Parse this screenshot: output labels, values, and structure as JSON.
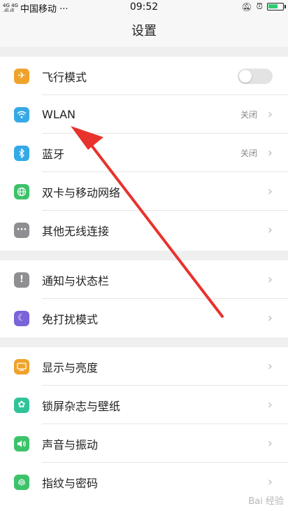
{
  "status_bar": {
    "network_top": "4G 4G",
    "network_bottom": ".ıll.ıll",
    "carrier": "中国移动 ···",
    "time": "09:52",
    "icons": [
      "silent-icon",
      "alarm-icon",
      "battery-icon"
    ]
  },
  "header": {
    "title": "设置"
  },
  "sections": [
    {
      "items": [
        {
          "id": "airplane",
          "label": "飞行模式",
          "icon": "airplane-icon",
          "color": "#f0a22b",
          "glyph": "✈",
          "control": "toggle",
          "toggle_on": false
        },
        {
          "id": "wlan",
          "label": "WLAN",
          "icon": "wifi-icon",
          "color": "#35a9e6",
          "glyph": "((·))",
          "value": "关闭",
          "control": "chevron"
        },
        {
          "id": "bluetooth",
          "label": "蓝牙",
          "icon": "bluetooth-icon",
          "color": "#35a9e6",
          "glyph": "ᛒ",
          "value": "关闭",
          "control": "chevron"
        },
        {
          "id": "dual-sim",
          "label": "双卡与移动网络",
          "icon": "globe-icon",
          "color": "#3cc36a",
          "glyph": "⊕",
          "control": "chevron"
        },
        {
          "id": "other-wireless",
          "label": "其他无线连接",
          "icon": "more-icon",
          "color": "#8e8e93",
          "glyph": "···",
          "control": "chevron"
        }
      ]
    },
    {
      "items": [
        {
          "id": "notifications",
          "label": "通知与状态栏",
          "icon": "exclamation-icon",
          "color": "#8e8e93",
          "glyph": "!",
          "control": "chevron"
        },
        {
          "id": "dnd",
          "label": "免打扰模式",
          "icon": "moon-icon",
          "color": "#7b63d9",
          "glyph": "☾",
          "control": "chevron"
        }
      ]
    },
    {
      "items": [
        {
          "id": "display",
          "label": "显示与亮度",
          "icon": "display-icon",
          "color": "#f0a22b",
          "glyph": "▭",
          "control": "chevron"
        },
        {
          "id": "lockscreen",
          "label": "锁屏杂志与壁纸",
          "icon": "flower-icon",
          "color": "#2fc39a",
          "glyph": "✿",
          "control": "chevron"
        },
        {
          "id": "sound",
          "label": "声音与振动",
          "icon": "speaker-icon",
          "color": "#3cc36a",
          "glyph": "◁)",
          "control": "chevron"
        },
        {
          "id": "fingerprint",
          "label": "指纹与密码",
          "icon": "fingerprint-icon",
          "color": "#3cc36a",
          "glyph": "◉",
          "control": "chevron"
        }
      ]
    }
  ],
  "chevron_glyph": "›",
  "annotation_arrow_color": "#e8322d",
  "watermark_text": "Bai 经验"
}
